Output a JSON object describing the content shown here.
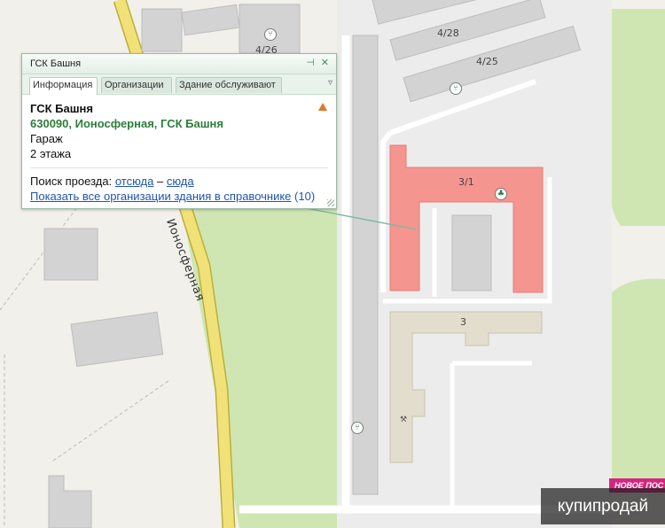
{
  "map": {
    "street_name": "Ионосферная",
    "house_labels": [
      "4/26",
      "4/28",
      "4/25",
      "3/1",
      "3"
    ],
    "poi_icons": [
      "cafe-icon",
      "cafe-icon",
      "cafe-icon",
      "pharmacy-icon",
      "sport-icon"
    ],
    "colors": {
      "background": "#f2f0ea",
      "green_area": "#cfe6b2",
      "road_main": "#f0e278",
      "road_side": "#ffffff",
      "building": "#d3d3d3",
      "building_selected": "#f59590",
      "building_beige": "#e3ddcd"
    }
  },
  "popup": {
    "title": "ГСК Башня",
    "pin_icon": "pin-icon",
    "close_icon": "close-icon",
    "tabs": [
      {
        "label": "Информация",
        "active": true
      },
      {
        "label": "Организации",
        "active": false
      },
      {
        "label": "Здание обслуживают",
        "active": false
      }
    ],
    "tabs_menu_icon": "chevron-down-icon",
    "name": "ГСК Башня",
    "address": "630090, Ионосферная, ГСК Башня",
    "category": "Гараж",
    "floors": "2 этажа",
    "route": {
      "prefix": "Поиск проезда:",
      "from_here": "отсюда",
      "dash": "–",
      "to_here": "сюда"
    },
    "show_all_link": "Показать все организации здания в справочнике",
    "show_all_count": "(10)",
    "warning_icon": "warning-icon"
  },
  "promo": {
    "banner_text": "НОВОЕ ПОС"
  },
  "watermark": {
    "text": "купипродай"
  }
}
